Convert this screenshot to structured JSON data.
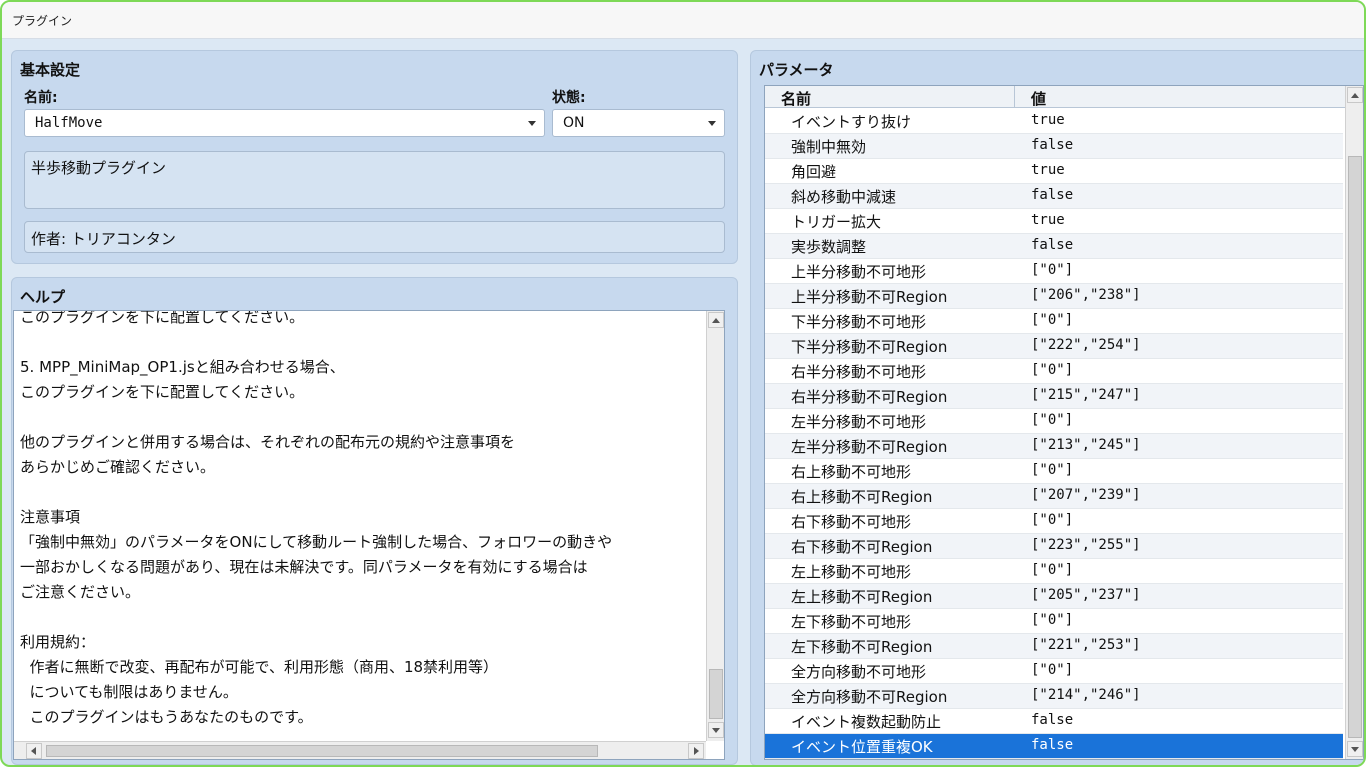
{
  "window": {
    "title": "プラグイン"
  },
  "basic": {
    "group_title": "基本設定",
    "name_label": "名前:",
    "name_value": "HalfMove",
    "status_label": "状態:",
    "status_value": "ON",
    "description": "半歩移動プラグイン",
    "author": "作者: トリアコンタン"
  },
  "help": {
    "group_title": "ヘルプ",
    "lines": [
      "このプラグインを下に配置してください。",
      "",
      "5. MPP_MiniMap_OP1.jsと組み合わせる場合、",
      "このプラグインを下に配置してください。",
      "",
      "他のプラグインと併用する場合は、それぞれの配布元の規約や注意事項を",
      "あらかじめご確認ください。",
      "",
      "注意事項",
      "「強制中無効」のパラメータをONにして移動ルート強制した場合、フォロワーの動きや",
      "一部おかしくなる問題があり、現在は未解決です。同パラメータを有効にする場合は",
      "ご注意ください。",
      "",
      "利用規約：",
      "  作者に無断で改変、再配布が可能で、利用形態（商用、18禁利用等）",
      "  についても制限はありません。",
      "  このプラグインはもうあなたのものです。"
    ]
  },
  "params": {
    "group_title": "パラメータ",
    "col_name": "名前",
    "col_value": "値",
    "selected_index": 25,
    "rows": [
      {
        "name": "イベントすり抜け",
        "value": "true"
      },
      {
        "name": "強制中無効",
        "value": "false"
      },
      {
        "name": "角回避",
        "value": "true"
      },
      {
        "name": "斜め移動中減速",
        "value": "false"
      },
      {
        "name": "トリガー拡大",
        "value": "true"
      },
      {
        "name": "実歩数調整",
        "value": "false"
      },
      {
        "name": "上半分移動不可地形",
        "value": "[\"0\"]"
      },
      {
        "name": "上半分移動不可Region",
        "value": "[\"206\",\"238\"]"
      },
      {
        "name": "下半分移動不可地形",
        "value": "[\"0\"]"
      },
      {
        "name": "下半分移動不可Region",
        "value": "[\"222\",\"254\"]"
      },
      {
        "name": "右半分移動不可地形",
        "value": "[\"0\"]"
      },
      {
        "name": "右半分移動不可Region",
        "value": "[\"215\",\"247\"]"
      },
      {
        "name": "左半分移動不可地形",
        "value": "[\"0\"]"
      },
      {
        "name": "左半分移動不可Region",
        "value": "[\"213\",\"245\"]"
      },
      {
        "name": "右上移動不可地形",
        "value": "[\"0\"]"
      },
      {
        "name": "右上移動不可Region",
        "value": "[\"207\",\"239\"]"
      },
      {
        "name": "右下移動不可地形",
        "value": "[\"0\"]"
      },
      {
        "name": "右下移動不可Region",
        "value": "[\"223\",\"255\"]"
      },
      {
        "name": "左上移動不可地形",
        "value": "[\"0\"]"
      },
      {
        "name": "左上移動不可Region",
        "value": "[\"205\",\"237\"]"
      },
      {
        "name": "左下移動不可地形",
        "value": "[\"0\"]"
      },
      {
        "name": "左下移動不可Region",
        "value": "[\"221\",\"253\"]"
      },
      {
        "name": "全方向移動不可地形",
        "value": "[\"0\"]"
      },
      {
        "name": "全方向移動不可Region",
        "value": "[\"214\",\"246\"]"
      },
      {
        "name": "イベント複数起動防止",
        "value": "false"
      },
      {
        "name": "イベント位置重複OK",
        "value": "false"
      }
    ]
  }
}
